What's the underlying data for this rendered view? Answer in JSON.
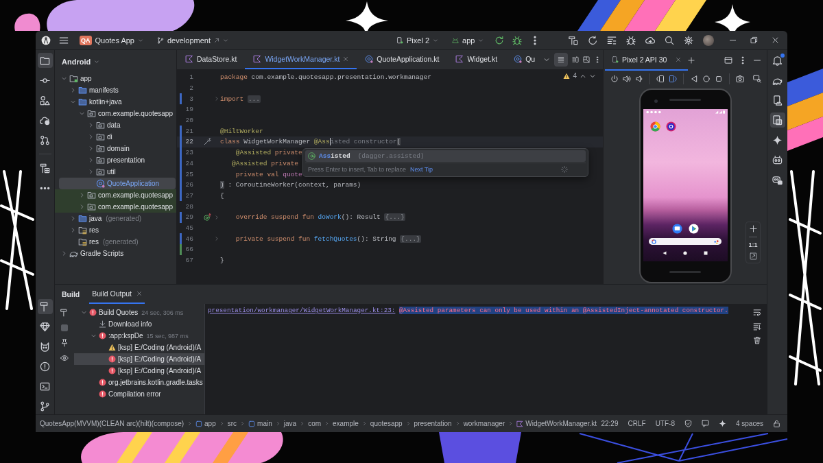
{
  "title_bar": {
    "project_badge": "QA",
    "project": "Quotes App",
    "branch": "development",
    "device": "Pixel 2",
    "run_config": "app"
  },
  "left_tools": [
    {
      "selected": true
    },
    {
      "selected": false
    },
    {
      "selected": false
    },
    {
      "selected": false
    },
    {
      "selected": false
    },
    {
      "selected": false
    },
    {
      "selected": false
    }
  ],
  "bottom_tools": [
    {
      "selected": true
    },
    {
      "selected": false
    },
    {
      "selected": false
    },
    {
      "selected": false
    },
    {
      "selected": false
    },
    {
      "selected": false
    }
  ],
  "right_tools": [
    {
      "selected": false,
      "unread": true
    },
    {
      "selected": false,
      "unread": false
    },
    {
      "selected": false,
      "unread": false
    },
    {
      "selected": true,
      "unread": false
    },
    {
      "selected": false,
      "unread": false
    },
    {
      "selected": false,
      "unread": false
    },
    {
      "selected": false,
      "unread": false
    }
  ],
  "project_panel": {
    "view": "Android",
    "tree": [
      {
        "label": "app",
        "kind": "module",
        "expanded": true,
        "selected": false,
        "children": [
          {
            "label": "manifests",
            "kind": "folder",
            "expanded": false,
            "selected": false
          },
          {
            "label": "kotlin+java",
            "kind": "folder",
            "expanded": true,
            "selected": false,
            "children": [
              {
                "label": "com.example.quotesapp",
                "kind": "package",
                "expanded": true,
                "selected": false,
                "children": [
                  {
                    "label": "data",
                    "kind": "package",
                    "expanded": false,
                    "selected": false
                  },
                  {
                    "label": "di",
                    "kind": "package",
                    "expanded": false,
                    "selected": false
                  },
                  {
                    "label": "domain",
                    "kind": "package",
                    "expanded": false,
                    "selected": false
                  },
                  {
                    "label": "presentation",
                    "kind": "package",
                    "expanded": false,
                    "selected": false
                  },
                  {
                    "label": "util",
                    "kind": "package",
                    "expanded": false,
                    "selected": false
                  },
                  {
                    "label": "QuoteApplication",
                    "kind": "class",
                    "selected": true
                  }
                ]
              },
              {
                "label": "com.example.quotesapp",
                "kind": "test-package",
                "expanded": false,
                "selected": false
              },
              {
                "label": "com.example.quotesapp",
                "kind": "test-package",
                "expanded": false,
                "selected": false
              }
            ]
          },
          {
            "label": "java",
            "note": "(generated)",
            "kind": "folder",
            "expanded": false,
            "selected": false
          },
          {
            "label": "res",
            "kind": "res",
            "expanded": false,
            "selected": false
          },
          {
            "label": "res",
            "note": "(generated)",
            "kind": "res",
            "selected": false
          }
        ]
      },
      {
        "label": "Gradle Scripts",
        "kind": "gradle",
        "expanded": false,
        "selected": false
      }
    ]
  },
  "editor": {
    "tabs": [
      {
        "label": "DataStore.kt",
        "kind": "kotlin",
        "selected": false
      },
      {
        "label": "WidgetWorkManager.kt",
        "kind": "kotlin",
        "selected": true
      },
      {
        "label": "QuoteApplication.kt",
        "kind": "app-class",
        "selected": false
      },
      {
        "label": "Widget.kt",
        "kind": "kotlin",
        "selected": false
      },
      {
        "label": "Qu",
        "kind": "app-class",
        "selected": false
      }
    ],
    "warnings": "4",
    "lines": [
      {
        "number": "1",
        "kind": "code",
        "current": false,
        "tokens": [
          {
            "text": "package ",
            "kind": "keyword"
          },
          {
            "text": "com.example.quotesapp.presentation.workmanager",
            "kind": "plain"
          }
        ]
      },
      {
        "number": "2",
        "kind": "code",
        "current": false
      },
      {
        "number": "3",
        "kind": "code",
        "color": "#3d68c4",
        "current": false,
        "folded": true,
        "tokens": [
          {
            "text": "import ",
            "kind": "keyword"
          },
          {
            "text": "...",
            "kind": "fold"
          }
        ]
      },
      {
        "number": "19",
        "kind": "code",
        "current": false
      },
      {
        "number": "20",
        "kind": "code",
        "current": false
      },
      {
        "number": "21",
        "kind": "code",
        "color": "#3d68c4",
        "current": false,
        "tokens": [
          {
            "text": "@HiltWorker",
            "kind": "annotation"
          }
        ]
      },
      {
        "number": "22",
        "kind": "hint",
        "color": "#3d68c4",
        "current": true,
        "tokens": [
          {
            "text": "class ",
            "kind": "keyword"
          },
          {
            "text": "WidgetWorkManager ",
            "kind": "plain"
          },
          {
            "text": "@Ass",
            "kind": "typed"
          },
          {
            "text": "isted constructor",
            "kind": "dim"
          },
          {
            "text": "(",
            "kind": "bracket"
          }
        ]
      },
      {
        "number": "23",
        "kind": "code",
        "color": "#3d68c4",
        "current": false,
        "tokens": [
          {
            "text": "    @Assisted ",
            "kind": "annotation"
          },
          {
            "text": "private",
            "kind": "keyword"
          }
        ]
      },
      {
        "number": "24",
        "kind": "code",
        "color": "#3d68c4",
        "current": false,
        "tokens": [
          {
            "text": "   @Assisted ",
            "kind": "annotation"
          },
          {
            "text": "private",
            "kind": "keyword"
          }
        ]
      },
      {
        "number": "25",
        "kind": "code",
        "color": "#3d68c4",
        "current": false,
        "tokens": [
          {
            "text": "    private val ",
            "kind": "keyword"
          },
          {
            "text": "quote",
            "kind": "property"
          }
        ]
      },
      {
        "number": "26",
        "kind": "code",
        "color": "#3d68c4",
        "current": false,
        "tokens": [
          {
            "text": ")",
            "kind": "bracket"
          },
          {
            "text": " : CoroutineWorker(context, params)",
            "kind": "plain"
          }
        ]
      },
      {
        "number": "27",
        "kind": "code",
        "color": "#3d68c4",
        "current": false,
        "tokens": [
          {
            "text": "{",
            "kind": "plain"
          }
        ]
      },
      {
        "number": "28",
        "kind": "code",
        "current": false
      },
      {
        "number": "29",
        "kind": "override",
        "color": "#3d68c4",
        "current": false,
        "folded": true,
        "tokens": [
          {
            "text": "    override suspend fun ",
            "kind": "keyword"
          },
          {
            "text": "doWork",
            "kind": "function"
          },
          {
            "text": "(): Result ",
            "kind": "plain"
          },
          {
            "text": "{...}",
            "kind": "fold"
          }
        ]
      },
      {
        "number": "45",
        "kind": "code",
        "current": false
      },
      {
        "number": "46",
        "kind": "code",
        "color": "#3d68c4",
        "current": false,
        "folded": true,
        "tokens": [
          {
            "text": "    private suspend fun ",
            "kind": "keyword"
          },
          {
            "text": "fetchQuotes",
            "kind": "function"
          },
          {
            "text": "(): String ",
            "kind": "plain"
          },
          {
            "text": "{...}",
            "kind": "fold"
          }
        ]
      },
      {
        "number": "66",
        "kind": "code",
        "color": "#4f8d56",
        "current": false
      },
      {
        "number": "67",
        "kind": "code",
        "current": false,
        "tokens": [
          {
            "text": "}",
            "kind": "plain"
          }
        ]
      }
    ],
    "completion": {
      "items": [
        {
          "match": "Ass",
          "rest": "isted",
          "package": "(dagger.assisted)",
          "selected": true
        }
      ],
      "hint": "Press Enter to insert, Tab to replace",
      "link": "Next Tip"
    }
  },
  "emulator": {
    "tabs": [
      {
        "label": "Pixel 2 API 30",
        "selected": true
      }
    ],
    "zoom_reset": "1:1"
  },
  "build": {
    "title": "Build",
    "tabs": [
      {
        "label": "Build Output",
        "selected": true
      }
    ],
    "tree": [
      {
        "label": "Build Quotes",
        "duration": "24 sec, 306 ms",
        "kind": "error",
        "expanded": true,
        "selected": false,
        "children": [
          {
            "label": "Download info",
            "kind": "download",
            "selected": false
          },
          {
            "label": ":app:kspDe",
            "duration": "15 sec, 987 ms",
            "kind": "error",
            "expanded": true,
            "selected": false,
            "children": [
              {
                "label": "[ksp] E:/Coding (Android)/A",
                "kind": "warning",
                "selected": false
              },
              {
                "label": "[ksp] E:/Coding (Android)/A",
                "kind": "error",
                "selected": true
              },
              {
                "label": "[ksp] E:/Coding (Android)/A",
                "kind": "error",
                "selected": false
              }
            ]
          },
          {
            "label": "org.jetbrains.kotlin.gradle.tasks",
            "kind": "error",
            "selected": false
          },
          {
            "label": "Compilation error",
            "kind": "error",
            "selected": false
          }
        ]
      }
    ],
    "output": {
      "link": "presentation/workmanager/WidgetWorkManager.kt:23:",
      "message": "@Assisted parameters can only be used within an @AssistedInject-annotated constructor.",
      "selected": true
    }
  },
  "status_bar": {
    "breadcrumbs": [
      {
        "label": "QuotesApp(MVVM)(CLEAN arc)(hilt)(compose)",
        "kind": "plain"
      },
      {
        "label": "app",
        "kind": "module"
      },
      {
        "label": "src",
        "kind": "plain"
      },
      {
        "label": "main",
        "kind": "source"
      },
      {
        "label": "java",
        "kind": "plain"
      },
      {
        "label": "com",
        "kind": "plain"
      },
      {
        "label": "example",
        "kind": "plain"
      },
      {
        "label": "quotesapp",
        "kind": "plain"
      },
      {
        "label": "presentation",
        "kind": "plain"
      },
      {
        "label": "workmanager",
        "kind": "plain"
      },
      {
        "label": "WidgetWorkManager.kt",
        "kind": "kotlin"
      }
    ],
    "position": "22:29",
    "line_separator": "CRLF",
    "encoding": "UTF-8",
    "indent": "4 spaces"
  }
}
